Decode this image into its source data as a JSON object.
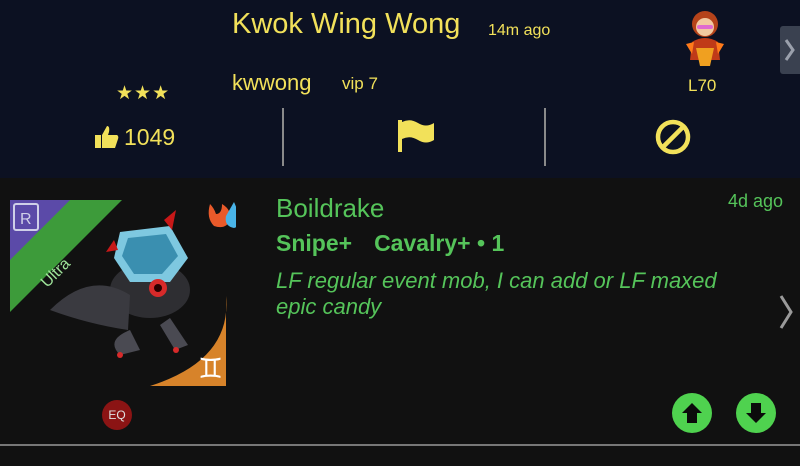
{
  "header": {
    "player_name": "Kwok Wing Wong",
    "posted_ago": "14m ago",
    "username": "kwwong",
    "vip": "vip 7",
    "stars": "★★★",
    "level": "L70",
    "likes": "1049"
  },
  "post": {
    "monster_name": "Boildrake",
    "rarity": "Ultra",
    "rarity_badge": "R",
    "trait_1": "Snipe+",
    "trait_2": "Cavalry+ • 1",
    "posted_ago": "4d ago",
    "message": "LF regular event mob, I can add or LF maxed epic candy",
    "eq_badge": "EQ"
  },
  "colors": {
    "header_bg": "#0c1122",
    "accent_yellow": "#f2e15a",
    "accent_green": "#55c45a",
    "vote_green": "#4fd24f"
  },
  "icons": [
    "thumbs-up-icon",
    "flag-icon",
    "block-icon",
    "chevron-right-icon",
    "arrow-up-icon",
    "arrow-down-icon",
    "fire-icon",
    "water-icon",
    "gemini-icon"
  ]
}
